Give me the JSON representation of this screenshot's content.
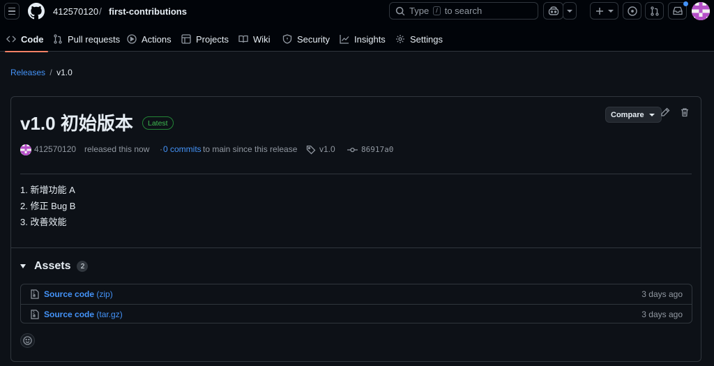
{
  "header": {
    "owner": "412570120",
    "separator": "/",
    "repo": "first-contributions",
    "search": {
      "prefix": "Type",
      "key": "/",
      "suffix": "to search"
    },
    "icons": [
      "hamburger-icon",
      "github-logo",
      "search-icon",
      "copilot-icon",
      "chevron-down-icon",
      "plus-icon",
      "issues-icon",
      "pull-request-icon",
      "inbox-icon",
      "avatar"
    ]
  },
  "tabs": [
    {
      "label": "Code",
      "icon": "code-icon",
      "active": true
    },
    {
      "label": "Pull requests",
      "icon": "pull-request-icon"
    },
    {
      "label": "Actions",
      "icon": "play-icon"
    },
    {
      "label": "Projects",
      "icon": "table-icon"
    },
    {
      "label": "Wiki",
      "icon": "book-icon"
    },
    {
      "label": "Security",
      "icon": "shield-icon"
    },
    {
      "label": "Insights",
      "icon": "graph-icon"
    },
    {
      "label": "Settings",
      "icon": "gear-icon"
    }
  ],
  "breadcrumb": {
    "parent": "Releases",
    "separator": "/",
    "current": "v1.0"
  },
  "release": {
    "title": "v1.0 初始版本",
    "badge": "Latest",
    "compare_label": "Compare",
    "author": "412570120",
    "released_text": "released this now",
    "commits_dot": "·",
    "commits_link": "0 commits",
    "commits_text": "to main since this release",
    "tag": "v1.0",
    "commit_sha": "86917a0",
    "notes": [
      "1. 新增功能 A",
      "2. 修正 Bug B",
      "3. 改善效能"
    ],
    "assets_title": "Assets",
    "assets_count": "2",
    "assets": [
      {
        "name": "Source code",
        "ext": "(zip)",
        "date": "3 days ago"
      },
      {
        "name": "Source code",
        "ext": "(tar.gz)",
        "date": "3 days ago"
      }
    ]
  },
  "colors": {
    "background": "#0d1117",
    "header_bg": "#010409",
    "border": "#30363d",
    "link": "#4493f8",
    "latest_green": "#3fb950",
    "active_tab_underline": "#f78166"
  }
}
